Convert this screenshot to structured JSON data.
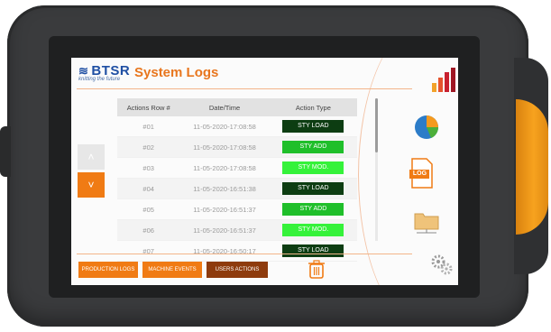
{
  "brand": {
    "logo_text": "BTSR",
    "tagline": "knitting the future"
  },
  "header": {
    "title": "System Logs"
  },
  "table": {
    "columns": [
      "Actions Row #",
      "Date/Time",
      "Action Type"
    ],
    "rows": [
      {
        "row": "#01",
        "datetime": "11-05-2020-17:08:58",
        "action": "STY LOAD"
      },
      {
        "row": "#02",
        "datetime": "11-05-2020-17:08:58",
        "action": "STY ADD"
      },
      {
        "row": "#03",
        "datetime": "11-05-2020-17:08:58",
        "action": "STY MOD."
      },
      {
        "row": "#04",
        "datetime": "11-05-2020-16:51:38",
        "action": "STY LOAD"
      },
      {
        "row": "#05",
        "datetime": "11-05-2020-16:51:37",
        "action": "STY ADD"
      },
      {
        "row": "#06",
        "datetime": "11-05-2020-16:51:37",
        "action": "STY MOD."
      },
      {
        "row": "#07",
        "datetime": "11-05-2020-16:50:17",
        "action": "STY LOAD"
      }
    ]
  },
  "action_colors": {
    "STY LOAD": "#0d3d12",
    "STY ADD": "#1fbf2a",
    "STY MOD.": "#35f23a"
  },
  "tabs": {
    "production": "PRODUCTION LOGS",
    "machine": "MACHINE EVENTS",
    "users": "USERS ACTIONS"
  },
  "sidebar": {
    "log_icon_text": "LOG"
  },
  "icons": [
    "bar-chart-icon",
    "pie-chart-icon",
    "log-file-icon",
    "folder-network-icon",
    "gears-icon",
    "trash-icon",
    "chevron-up-icon",
    "chevron-down-icon"
  ],
  "colors": {
    "accent": "#f07b14",
    "active_tab": "#8e3b0d",
    "brand_blue": "#1f4fa3"
  }
}
